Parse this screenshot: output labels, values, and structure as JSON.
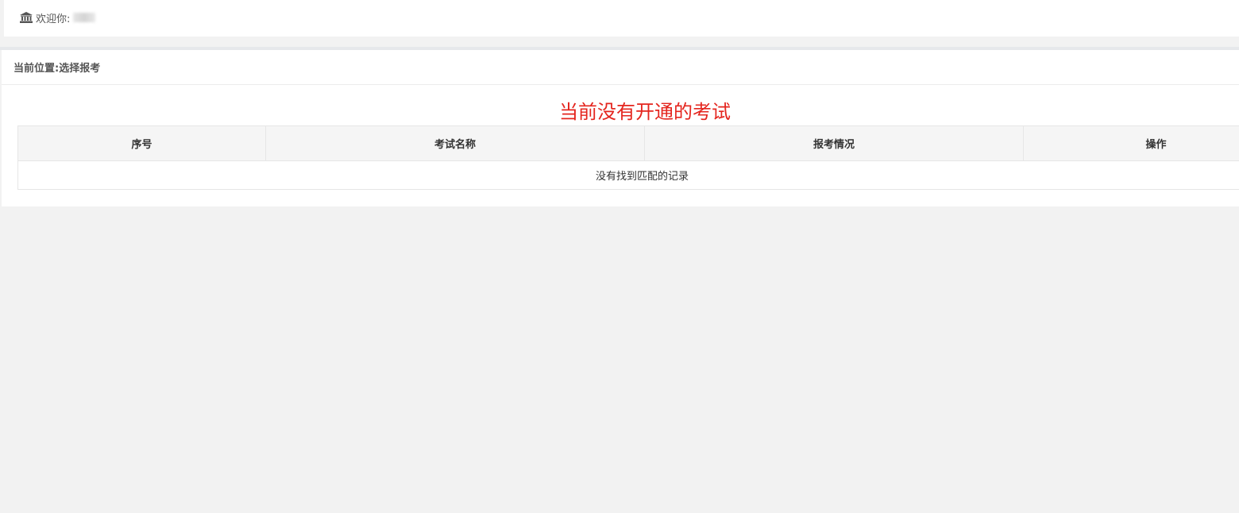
{
  "header": {
    "welcome_label": "欢迎你:",
    "icon": "bank-icon"
  },
  "breadcrumb": {
    "text": "当前位置:选择报考"
  },
  "notice": {
    "text": "当前没有开通的考试"
  },
  "table": {
    "columns": [
      "序号",
      "考试名称",
      "报考情况",
      "操作"
    ],
    "empty_text": "没有找到匹配的记录"
  },
  "colors": {
    "notice": "#e4251e",
    "background": "#f2f2f2",
    "header_bg": "#f5f5f5"
  }
}
